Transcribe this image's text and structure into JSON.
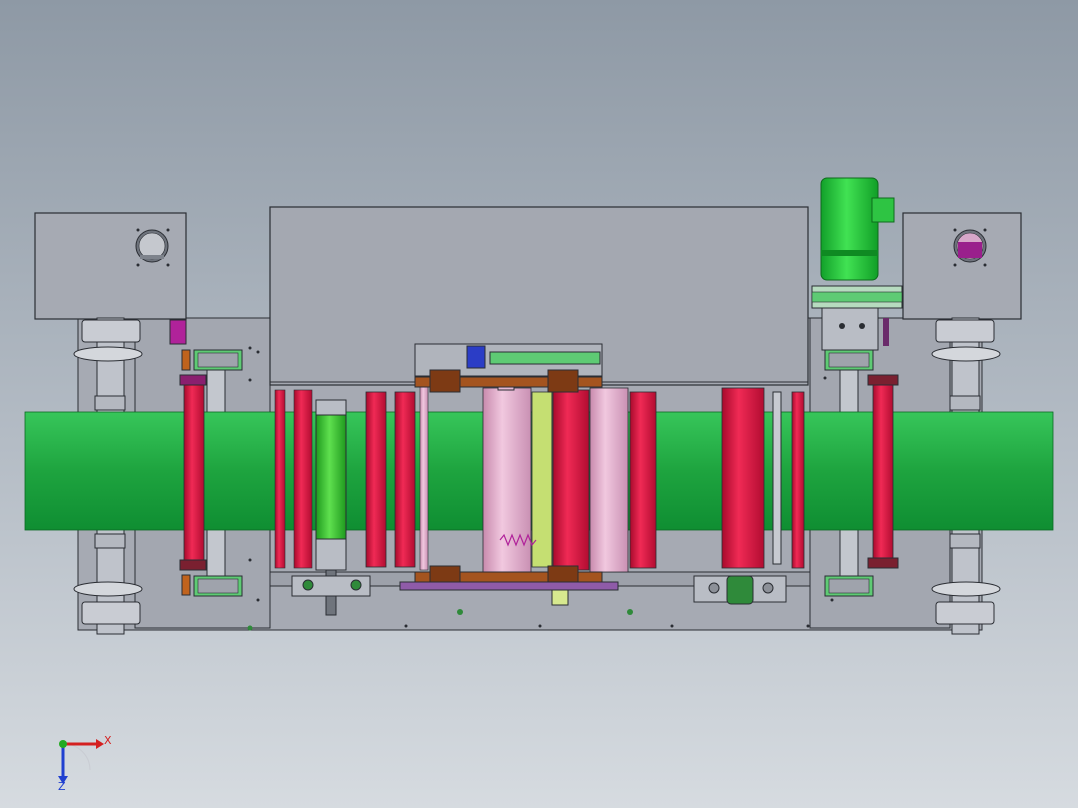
{
  "scene": {
    "colors": {
      "frame": "#a9adb6",
      "frame_dark": "#8d929c",
      "outline": "#2a2d33",
      "belt": "#1fa540",
      "belt_light": "#3dcc63",
      "roller_red": "#d8123f",
      "roller_pink": "#e3b1cc",
      "roller_green": "#35c12f",
      "roller_lime": "#c9e07a",
      "shaft": "#bfc3cb",
      "motor_green": "#23c13a",
      "bracket_green": "#5ecb74",
      "brown": "#a4541f",
      "magenta": "#b0229a",
      "blue": "#2b3dc6",
      "flange": "#c9ccd3"
    },
    "icons": {
      "motor": "gear-motor-icon",
      "rollers": "cylinder-roller-icon",
      "cylinders": "pneumatic-cylinder-icon"
    }
  },
  "triad": {
    "x_label": "X",
    "z_label": "Z",
    "x_color": "#d42020",
    "y_color": "#22aa22",
    "z_color": "#2040d0"
  }
}
